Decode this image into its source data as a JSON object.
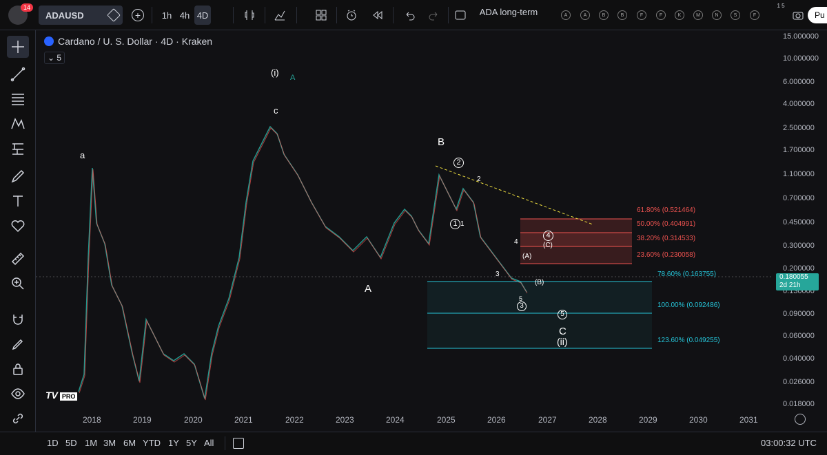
{
  "header": {
    "notification_count": "14",
    "symbol": "ADAUSD",
    "timeframes": [
      "1h",
      "4h",
      "4D"
    ],
    "layout_name": "ADA long-term",
    "alert_letters": [
      "A",
      "A",
      "B",
      "B",
      "F",
      "F",
      "K",
      "M",
      "N",
      "S",
      "F"
    ],
    "publish_label": "Pu",
    "badge_small": "1 5"
  },
  "chart": {
    "legend_title": "Cardano / U. S. Dollar · 4D · Kraken",
    "indicator_count": "5",
    "current_price": "0.180055",
    "countdown": "2d 21h",
    "price_ticks": [
      "15.000000",
      "10.000000",
      "6.000000",
      "4.000000",
      "2.500000",
      "1.700000",
      "1.100000",
      "0.700000",
      "0.450000",
      "0.300000",
      "0.200000",
      "0.130000",
      "0.090000",
      "0.060000",
      "0.040000",
      "0.026000",
      "0.018000"
    ],
    "time_ticks": [
      "2018",
      "2019",
      "2020",
      "2021",
      "2022",
      "2023",
      "2024",
      "2025",
      "2026",
      "2027",
      "2028",
      "2029",
      "2030",
      "2031"
    ],
    "wave_labels": [
      "a",
      "(i)",
      "A",
      "c",
      "B",
      "2",
      "2",
      "1",
      "1",
      "4",
      "4",
      "(C)",
      "(A)",
      "3",
      "(B)",
      "A",
      "5",
      "3",
      "5",
      "C",
      "(ii)"
    ],
    "fib_levels": [
      "61.80% (0.521464)",
      "50.00% (0.404991)",
      "38.20% (0.314533)",
      "23.60% (0.230058)",
      "78.60% (0.163755)",
      "100.00% (0.092486)",
      "123.60% (0.049255)"
    ],
    "watermark": "TV",
    "watermark_pro": "PRO"
  },
  "footer": {
    "ranges": [
      "1D",
      "5D",
      "1M",
      "3M",
      "6M",
      "YTD",
      "1Y",
      "5Y",
      "All"
    ],
    "clock": "03:00:32 UTC"
  },
  "colors": {
    "up": "#26a69a",
    "down": "#ef5350",
    "fib_red": "#ef5350",
    "fib_teal": "#26a69a",
    "trend": "#f0e040"
  }
}
